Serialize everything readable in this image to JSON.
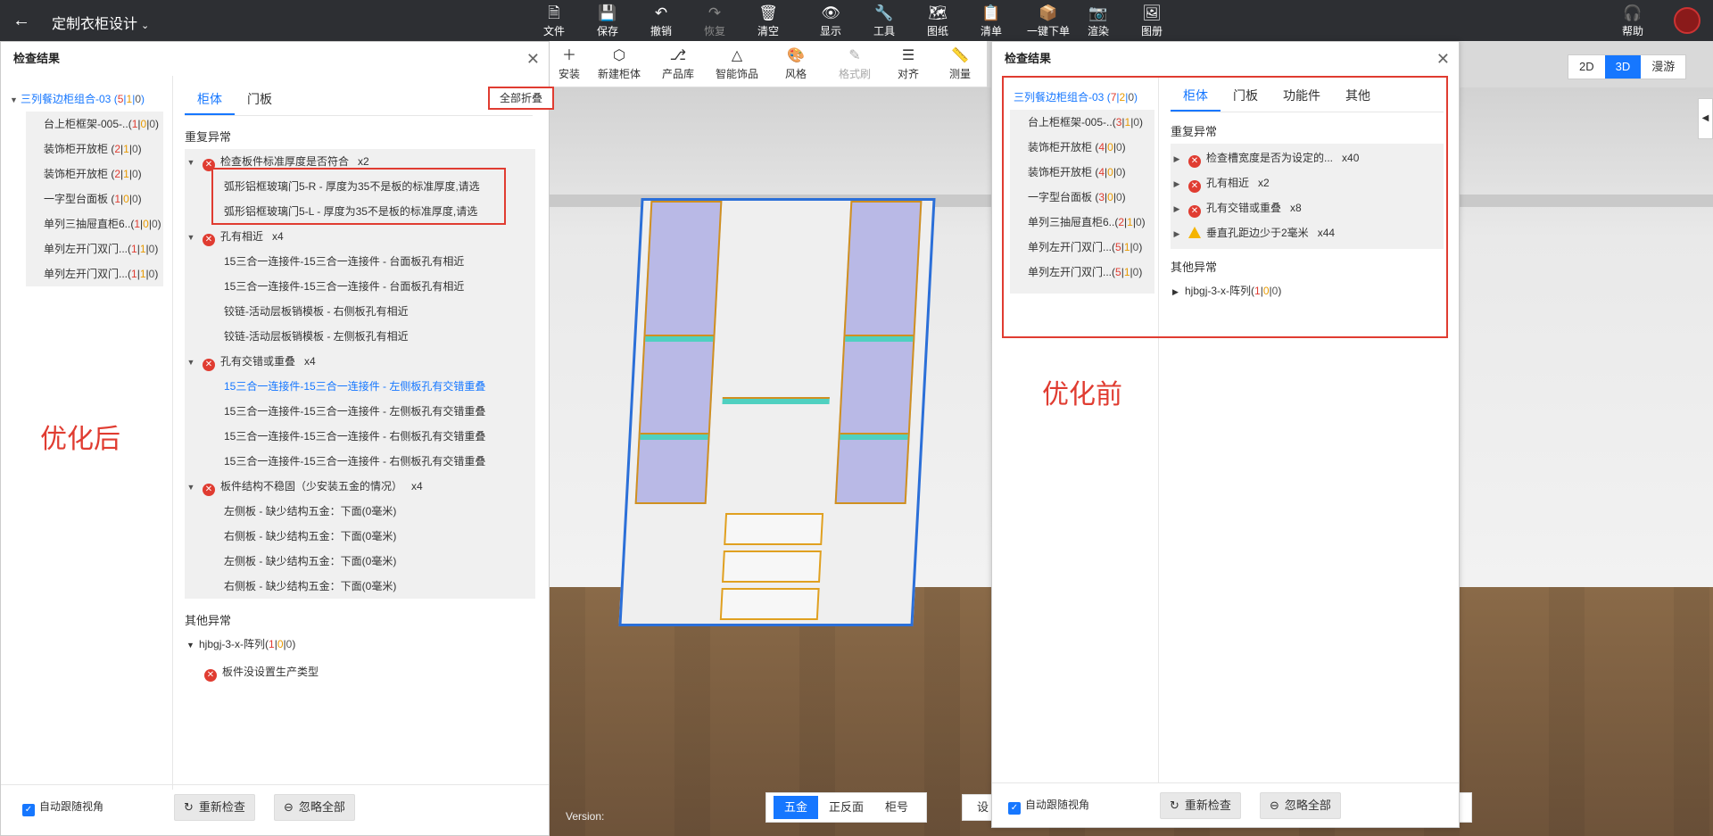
{
  "topbar": {
    "back_icon": "arrow-left-icon",
    "title": "定制衣柜设计",
    "tools": [
      {
        "label": "文件",
        "icon": "file-icon"
      },
      {
        "label": "保存",
        "icon": "save-icon"
      },
      {
        "label": "撤销",
        "icon": "undo-icon"
      },
      {
        "label": "恢复",
        "icon": "redo-icon"
      },
      {
        "label": "清空",
        "icon": "clear-icon"
      },
      {
        "label": "显示",
        "icon": "eye-icon"
      },
      {
        "label": "工具",
        "icon": "wrench-icon"
      },
      {
        "label": "图纸",
        "icon": "map-icon"
      },
      {
        "label": "清单",
        "icon": "clipboard-icon"
      },
      {
        "label": "一键下单",
        "icon": "order-icon"
      },
      {
        "label": "渲染",
        "icon": "camera-icon"
      },
      {
        "label": "图册",
        "icon": "album-icon"
      }
    ],
    "help_label": "帮助"
  },
  "subbar": {
    "tools": [
      {
        "label": "安装",
        "icon": "plus-icon"
      },
      {
        "label": "新建柜体",
        "icon": "cube-icon"
      },
      {
        "label": "产品库",
        "icon": "chair-icon"
      },
      {
        "label": "智能饰品",
        "icon": "bag-icon"
      },
      {
        "label": "风格",
        "icon": "palette-icon"
      },
      {
        "label": "格式刷",
        "icon": "brush-icon"
      },
      {
        "label": "对齐",
        "icon": "align-icon"
      },
      {
        "label": "测量",
        "icon": "ruler-icon"
      }
    ]
  },
  "view_toggle": [
    "2D",
    "3D",
    "漫游"
  ],
  "bottom_tabs": [
    "五金",
    "正反面",
    "柜号"
  ],
  "settings_label": "设",
  "version_label": "Version:",
  "left_panel": {
    "title": "检查结果",
    "collapse_all": "全部折叠",
    "groups": [
      {
        "name": "三列餐边柜组合-03",
        "c": [
          "5",
          "1",
          "0"
        ]
      },
      {
        "name": "台上柜框架-005-..",
        "c": [
          "1",
          "0",
          "0"
        ]
      },
      {
        "name": "装饰柜开放柜",
        "c": [
          "2",
          "1",
          "0"
        ]
      },
      {
        "name": "装饰柜开放柜",
        "c": [
          "2",
          "1",
          "0"
        ]
      },
      {
        "name": "一字型台面板",
        "c": [
          "1",
          "0",
          "0"
        ]
      },
      {
        "name": "单列三抽屉直柜6..",
        "c": [
          "1",
          "0",
          "0"
        ]
      },
      {
        "name": "单列左开门双门...",
        "c": [
          "1",
          "1",
          "0"
        ]
      },
      {
        "name": "单列左开门双门...",
        "c": [
          "1",
          "1",
          "0"
        ]
      }
    ],
    "tabs": [
      "柜体",
      "门板"
    ],
    "dup_title": "重复异常",
    "issues": [
      {
        "title": "检查板件标准厚度是否符合",
        "mult": "x2",
        "children": [
          "弧形铝框玻璃门5-R - 厚度为35不是板的标准厚度,请选",
          "弧形铝框玻璃门5-L - 厚度为35不是板的标准厚度,请选"
        ]
      },
      {
        "title": "孔有相近",
        "mult": "x4",
        "children": [
          "15三合一连接件-15三合一连接件 - 台面板孔有相近",
          "15三合一连接件-15三合一连接件 - 台面板孔有相近",
          "铰链-活动层板销模板 - 右侧板孔有相近",
          "铰链-活动层板销模板 - 左侧板孔有相近"
        ]
      },
      {
        "title": "孔有交错或重叠",
        "mult": "x4",
        "children": [
          "15三合一连接件-15三合一连接件 - 左侧板孔有交错重叠",
          "15三合一连接件-15三合一连接件 - 左侧板孔有交错重叠",
          "15三合一连接件-15三合一连接件 - 右侧板孔有交错重叠",
          "15三合一连接件-15三合一连接件 - 右侧板孔有交错重叠"
        ]
      },
      {
        "title": "板件结构不稳固（少安装五金的情况）",
        "mult": "x4",
        "children": [
          "左侧板 - 缺少结构五金：下面(0毫米)",
          "右侧板 - 缺少结构五金：下面(0毫米)",
          "左侧板 - 缺少结构五金：下面(0毫米)",
          "右侧板 - 缺少结构五金：下面(0毫米)"
        ]
      }
    ],
    "other_title": "其他异常",
    "other_group": {
      "name": "hjbgj-3-x-阵列",
      "c": [
        "1",
        "0",
        "0"
      ]
    },
    "other_item": "板件没设置生产类型",
    "annotation": "优化后",
    "footer": {
      "follow": "自动跟随视角",
      "recheck": "重新检查",
      "ignore_all": "忽略全部"
    }
  },
  "right_panel": {
    "title": "检查结果",
    "groups": [
      {
        "name": "三列餐边柜组合-03",
        "c": [
          "7",
          "2",
          "0"
        ]
      },
      {
        "name": "台上柜框架-005-..",
        "c": [
          "3",
          "1",
          "0"
        ]
      },
      {
        "name": "装饰柜开放柜",
        "c": [
          "4",
          "0",
          "0"
        ]
      },
      {
        "name": "装饰柜开放柜",
        "c": [
          "4",
          "0",
          "0"
        ]
      },
      {
        "name": "一字型台面板",
        "c": [
          "3",
          "0",
          "0"
        ]
      },
      {
        "name": "单列三抽屉直柜6..",
        "c": [
          "2",
          "1",
          "0"
        ]
      },
      {
        "name": "单列左开门双门...",
        "c": [
          "5",
          "1",
          "0"
        ]
      },
      {
        "name": "单列左开门双门...",
        "c": [
          "5",
          "1",
          "0"
        ]
      }
    ],
    "tabs": [
      "柜体",
      "门板",
      "功能件",
      "其他"
    ],
    "dup_title": "重复异常",
    "issues": [
      {
        "type": "error",
        "title": "检查槽宽度是否为设定的...",
        "mult": "x40"
      },
      {
        "type": "error",
        "title": "孔有相近",
        "mult": "x2"
      },
      {
        "type": "error",
        "title": "孔有交错或重叠",
        "mult": "x8"
      },
      {
        "type": "warning",
        "title": "垂直孔距边少于2毫米",
        "mult": "x44"
      }
    ],
    "other_title": "其他异常",
    "other_group": {
      "name": "hjbgj-3-x-阵列",
      "c": [
        "1",
        "0",
        "0"
      ]
    },
    "annotation": "优化前",
    "footer": {
      "follow": "自动跟随视角",
      "recheck": "重新检查",
      "ignore_all": "忽略全部"
    }
  },
  "colors": {
    "accent": "#1677ff",
    "error": "#e03c31",
    "warning": "#f5b400",
    "topbar": "#2d2f33"
  }
}
